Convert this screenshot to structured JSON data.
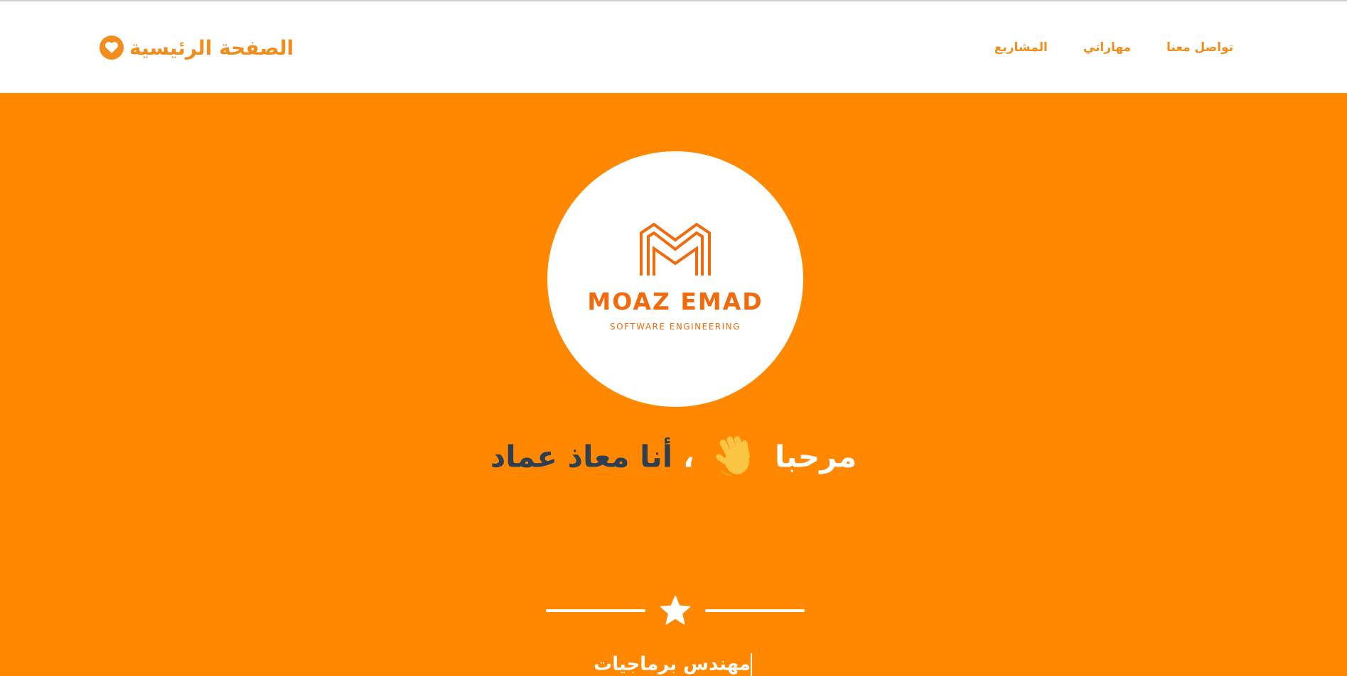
{
  "navbar": {
    "brand_label": "الصفحة الرئيسية",
    "brand_icon": "heart-icon",
    "links": [
      {
        "label": "تواصل معنا"
      },
      {
        "label": "مهاراتي"
      },
      {
        "label": "المشاريع"
      }
    ]
  },
  "hero": {
    "logo": {
      "title": "MOAZ EMAD",
      "subtitle": "SOFTWARE ENGINEERING",
      "icon": "m-monogram-logo"
    },
    "greeting_prefix": "مرحبا",
    "wave_icon": "waving-hand-icon",
    "greeting_separator": "، ",
    "greeting_name": "أنا معاذ عماد",
    "divider_icon": "star-icon",
    "role_text": "مهندس برماجيات"
  },
  "colors": {
    "accent": "#ff8800",
    "brand_text": "#f28c1c",
    "name_color": "#2c3e50",
    "logo_color": "#f26a0c"
  }
}
